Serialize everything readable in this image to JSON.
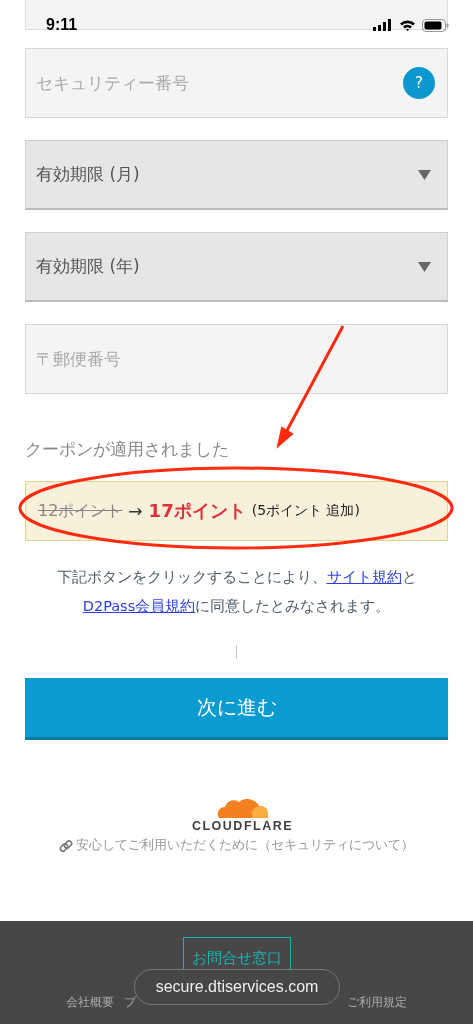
{
  "status_bar": {
    "time": "9:11"
  },
  "fields": [
    {
      "kind": "help",
      "placeholder": "セキュリティー番号",
      "help": "?"
    },
    {
      "kind": "select",
      "placeholder": "有効期限 (月)"
    },
    {
      "kind": "select",
      "placeholder": "有効期限 (年)"
    },
    {
      "kind": "text",
      "placeholder": "〒郵便番号"
    }
  ],
  "coupon": {
    "label": "クーポンが適用されました",
    "old_points": "12ポイント",
    "arrow": "→",
    "new_points": "17ポイント",
    "added": "(5ポイント 追加)"
  },
  "terms": {
    "before": "下記ボタンをクリックすることにより、",
    "link1": "サイト規約",
    "middle": "と",
    "link2": "D2Pass会員規約",
    "after": "に同意したとみなされます。"
  },
  "next_button": "次に進む",
  "security": {
    "brand": "CLOUDFLARE",
    "link": "安心してご利用いただくために（セキュリティについて）"
  },
  "footer": {
    "contact": "お問合せ窓口",
    "links": [
      "会社概要",
      "プ",
      "ご利用規定"
    ]
  },
  "url_bar": {
    "url": "secure.dtiservices.com"
  },
  "annotation": {
    "kind": "arrow-and-ellipse"
  }
}
